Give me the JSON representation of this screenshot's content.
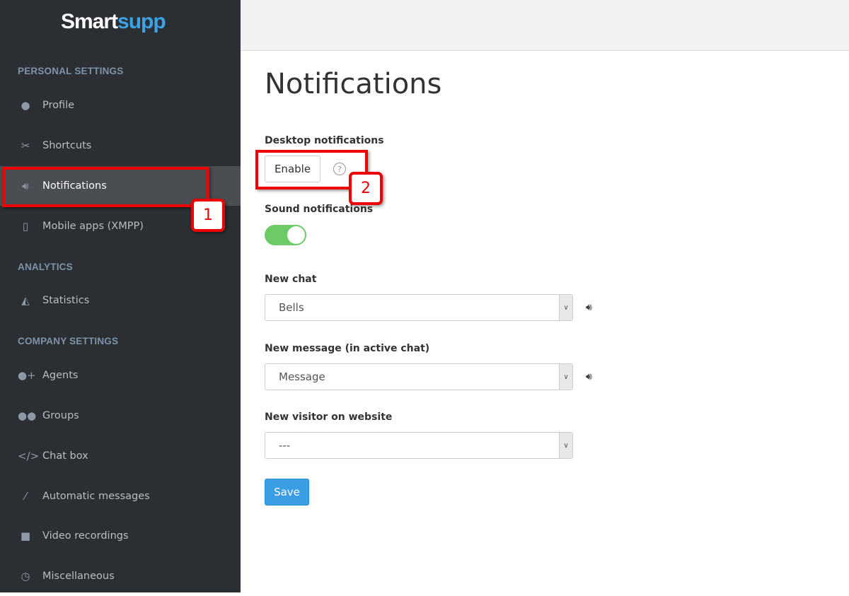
{
  "logo": {
    "part1": "Smart",
    "part2": "supp"
  },
  "sidebar": {
    "sections": [
      "PERSONAL SETTINGS",
      "ANALYTICS",
      "COMPANY SETTINGS"
    ],
    "items": [
      {
        "label": "Profile",
        "icon": "user-icon"
      },
      {
        "label": "Shortcuts",
        "icon": "scissors-icon"
      },
      {
        "label": "Notifications",
        "icon": "speaker-icon"
      },
      {
        "label": "Mobile apps (XMPP)",
        "icon": "mobile-icon"
      },
      {
        "label": "Statistics",
        "icon": "area-chart-icon"
      },
      {
        "label": "Agents",
        "icon": "user-plus-icon"
      },
      {
        "label": "Groups",
        "icon": "users-icon"
      },
      {
        "label": "Chat box",
        "icon": "code-icon"
      },
      {
        "label": "Automatic messages",
        "icon": "magic-wand-icon"
      },
      {
        "label": "Video recordings",
        "icon": "video-icon"
      },
      {
        "label": "Miscellaneous",
        "icon": "clock-icon"
      }
    ]
  },
  "main": {
    "title": "Notifications",
    "desktop_label": "Desktop notifications",
    "enable_label": "Enable",
    "help": "?",
    "sound_label": "Sound notifications",
    "sound_enabled": true,
    "new_chat_label": "New chat",
    "new_chat_value": "Bells",
    "new_message_label": "New message (in active chat)",
    "new_message_value": "Message",
    "new_visitor_label": "New visitor on website",
    "new_visitor_value": "---",
    "save_label": "Save"
  },
  "annotations": [
    "1",
    "2"
  ],
  "colors": {
    "accent": "#3a9ee4",
    "toggle": "#6ccb67",
    "annotation": "#ee0000"
  }
}
